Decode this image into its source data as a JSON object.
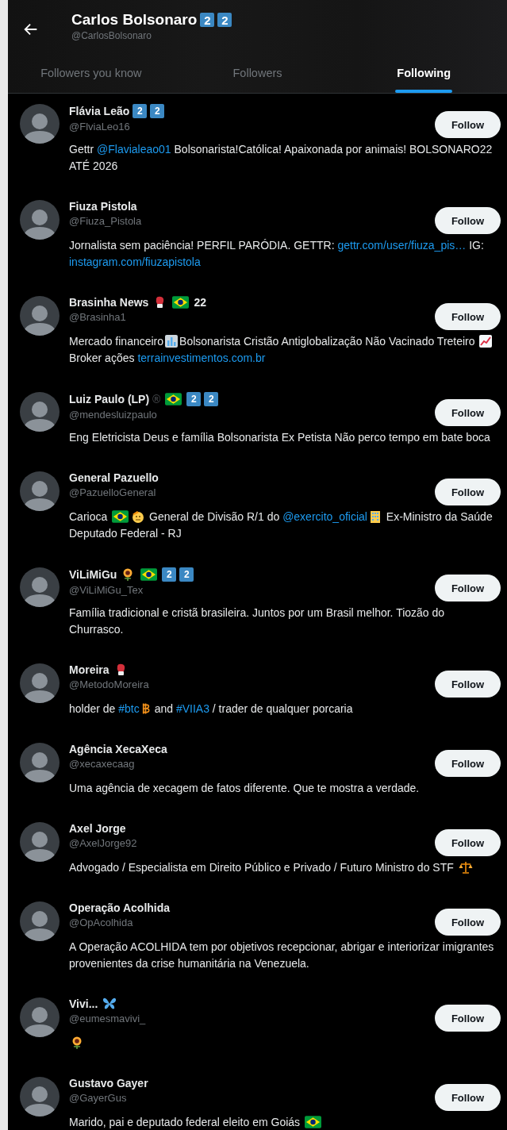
{
  "header": {
    "name": "Carlos Bolsonaro",
    "badges": [
      {
        "kind": "keycap",
        "text": "2"
      },
      {
        "kind": "keycap",
        "text": "2"
      }
    ],
    "handle": "@CarlosBolsonaro"
  },
  "tabs": [
    {
      "label": "Followers you know",
      "selected": false
    },
    {
      "label": "Followers",
      "selected": false
    },
    {
      "label": "Following",
      "selected": true
    }
  ],
  "users": [
    {
      "name": "Flávia Leão",
      "badges": [
        {
          "kind": "keycap",
          "text": "2"
        },
        {
          "kind": "keycap",
          "text": "2"
        }
      ],
      "handle": "@FlviaLeo16",
      "button": "Follow",
      "bio": [
        {
          "kind": "text",
          "text": "Gettr "
        },
        {
          "kind": "link",
          "text": "@Flavialeao01"
        },
        {
          "kind": "text",
          "text": " Bolsonarista!Católica! Apaixonada por animais! BOLSONARO22 ATÉ 2026"
        }
      ]
    },
    {
      "name": "Fiuza Pistola",
      "handle": "@Fiuza_Pistola",
      "button": "Follow",
      "bio": [
        {
          "kind": "text",
          "text": "Jornalista sem paciência! PERFIL PARÓDIA. GETTR: "
        },
        {
          "kind": "link",
          "text": "gettr.com/user/fiuza_pis…"
        },
        {
          "kind": "text",
          "text": " IG: "
        },
        {
          "kind": "link",
          "text": "instagram.com/fiuzapistola"
        }
      ]
    },
    {
      "name": "Brasinha News",
      "badges": [
        {
          "kind": "glove"
        },
        {
          "kind": "flag"
        },
        {
          "kind": "text",
          "text": "22"
        }
      ],
      "handle": "@Brasinha1",
      "button": "Follow",
      "bio": [
        {
          "kind": "text",
          "text": "Mercado financeiro"
        },
        {
          "kind": "barchart"
        },
        {
          "kind": "text",
          "text": "Bolsonarista Cristão Antiglobalização Não Vacinado Treteiro "
        },
        {
          "kind": "trend"
        },
        {
          "kind": "text",
          "text": " Broker ações "
        },
        {
          "kind": "link",
          "text": "terrainvestimentos.com.br"
        }
      ]
    },
    {
      "name": "Luiz Paulo (LP)",
      "badges": [
        {
          "kind": "mark",
          "text": "®"
        },
        {
          "kind": "flag"
        },
        {
          "kind": "keycap",
          "text": "2"
        },
        {
          "kind": "keycap",
          "text": "2"
        }
      ],
      "handle": "@mendesluizpaulo",
      "button": "Follow",
      "bio": [
        {
          "kind": "text",
          "text": "Eng Eletricista Deus e família Bolsonarista Ex Petista Não perco tempo em bate boca"
        }
      ]
    },
    {
      "name": "General Pazuello",
      "handle": "@PazuelloGeneral",
      "button": "Follow",
      "bio": [
        {
          "kind": "text",
          "text": "Carioca "
        },
        {
          "kind": "flag"
        },
        {
          "kind": "salute"
        },
        {
          "kind": "text",
          "text": " General de Divisão R/1 do "
        },
        {
          "kind": "link",
          "text": "@exercito_oficial"
        },
        {
          "kind": "building"
        },
        {
          "kind": "text",
          "text": " Ex-Ministro da Saúde Deputado Federal - RJ"
        }
      ]
    },
    {
      "name": "ViLiMiGu",
      "badges": [
        {
          "kind": "sunflower"
        },
        {
          "kind": "flag"
        },
        {
          "kind": "keycap",
          "text": "2"
        },
        {
          "kind": "keycap",
          "text": "2"
        }
      ],
      "handle": "@ViLiMiGu_Tex",
      "button": "Follow",
      "bio": [
        {
          "kind": "text",
          "text": "Família tradicional e cristã brasileira. Juntos por um Brasil melhor. Tiozão do Churrasco."
        }
      ]
    },
    {
      "name": "Moreira",
      "badges": [
        {
          "kind": "glove"
        }
      ],
      "handle": "@MetodoMoreira",
      "button": "Follow",
      "bio": [
        {
          "kind": "text",
          "text": "holder de "
        },
        {
          "kind": "link",
          "text": "#btc"
        },
        {
          "kind": "bitcoin"
        },
        {
          "kind": "text",
          "text": "  and "
        },
        {
          "kind": "link",
          "text": "#VIIA3"
        },
        {
          "kind": "text",
          "text": " / trader de qualquer porcaria"
        }
      ]
    },
    {
      "name": "Agência XecaXeca",
      "handle": "@xecaxecaag",
      "button": "Follow",
      "bio": [
        {
          "kind": "text",
          "text": "Uma agência de xecagem de fatos diferente. Que te mostra a verdade."
        }
      ]
    },
    {
      "name": "Axel Jorge",
      "handle": "@AxelJorge92",
      "button": "Follow",
      "bio": [
        {
          "kind": "text",
          "text": "Advogado / Especialista em Direito Público e Privado / Futuro Ministro do STF "
        },
        {
          "kind": "scales"
        }
      ]
    },
    {
      "name": "Operação Acolhida",
      "handle": "@OpAcolhida",
      "button": "Follow",
      "bio": [
        {
          "kind": "text",
          "text": "A Operação ACOLHIDA tem por objetivos recepcionar, abrigar e interiorizar imigrantes provenientes da crise humanitária na Venezuela."
        }
      ]
    },
    {
      "name": "Vivi...",
      "badges": [
        {
          "kind": "butterfly"
        }
      ],
      "handle": "@eumesmavivi_",
      "button": "Follow",
      "bio": [
        {
          "kind": "sunflower"
        }
      ]
    },
    {
      "name": "Gustavo Gayer",
      "handle": "@GayerGus",
      "button": "Follow",
      "bio": [
        {
          "kind": "text",
          "text": "Marido, pai e deputado federal eleito em Goiás "
        },
        {
          "kind": "flag"
        }
      ]
    }
  ]
}
